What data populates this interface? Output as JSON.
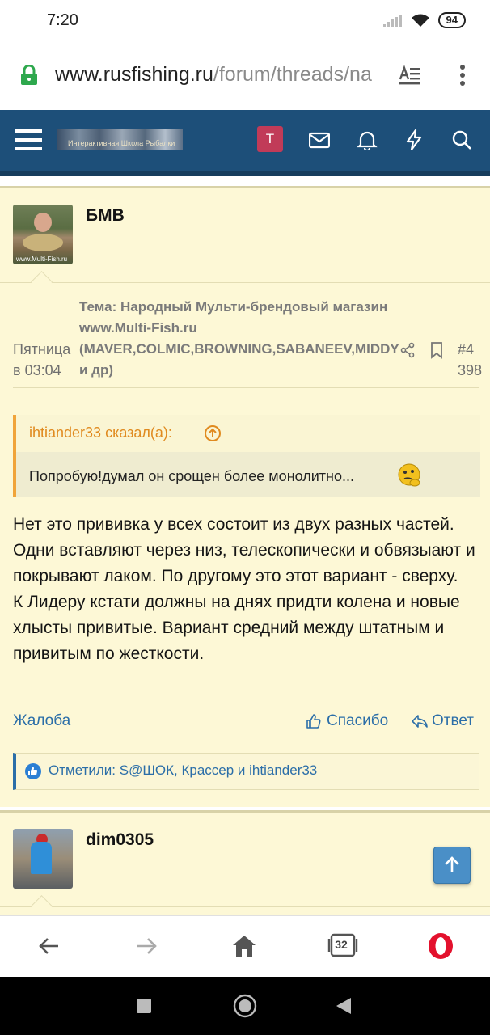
{
  "status": {
    "time": "7:20",
    "battery": "94"
  },
  "browser": {
    "url_host": "www.rusfishing.ru",
    "url_path": "/forum/threads/na",
    "tabs_count": "32"
  },
  "nav": {
    "avatar_letter": "T",
    "logo_caption": "Интерактивная Школа Рыбалки"
  },
  "posts": [
    {
      "username": "БМВ",
      "avatar_watermark": "www.Multi-Fish.ru",
      "date_line1": "Пятница",
      "date_line2": "в 03:04",
      "thread_title": "Тема: Народный Мульти-брендовый магазин www.Multi-Fish.ru (MAVER,COLMIC,BROWNING,SABANEEV,MIDDY и др)",
      "post_number_line1": "#4",
      "post_number_line2": "398",
      "quote_author": "ihtiander33 сказал(а):",
      "quote_text": "Попробую!думал он срощен более монолитно...",
      "message_p1": "Нет это прививка у всех состоит из двух разных частей. Одни вставляют через низ, телескопически и обвязыают и покрывают лаком. По другому это этот вариант - сверху.",
      "message_p2": "К Лидеру кстати должны на днях придти колена и новые хлысты привитые. Вариант средний между штатным и привитым по жесткости.",
      "report_label": "Жалоба",
      "like_label": "Спасибо",
      "reply_label": "Ответ",
      "likes_text": "Отметили: S@ШОК, Крассер и ihtiander33"
    },
    {
      "username": "dim0305"
    }
  ],
  "colors": {
    "nav_bg": "#1d4f79",
    "post_bg": "#fdf8d6",
    "link": "#2b6ea8",
    "quote_accent": "#f0a43a",
    "opera_red": "#e3112d"
  },
  "icons": [
    "lock-icon",
    "reader-mode-icon",
    "more-menu-icon",
    "hamburger-icon",
    "mail-icon",
    "bell-icon",
    "bolt-icon",
    "search-icon",
    "share-icon",
    "bookmark-icon",
    "up-arrow-icon",
    "thumbs-up-icon",
    "reply-arrow-icon",
    "like-badge-icon",
    "back-icon",
    "forward-icon",
    "home-icon",
    "tabs-icon",
    "opera-icon"
  ]
}
